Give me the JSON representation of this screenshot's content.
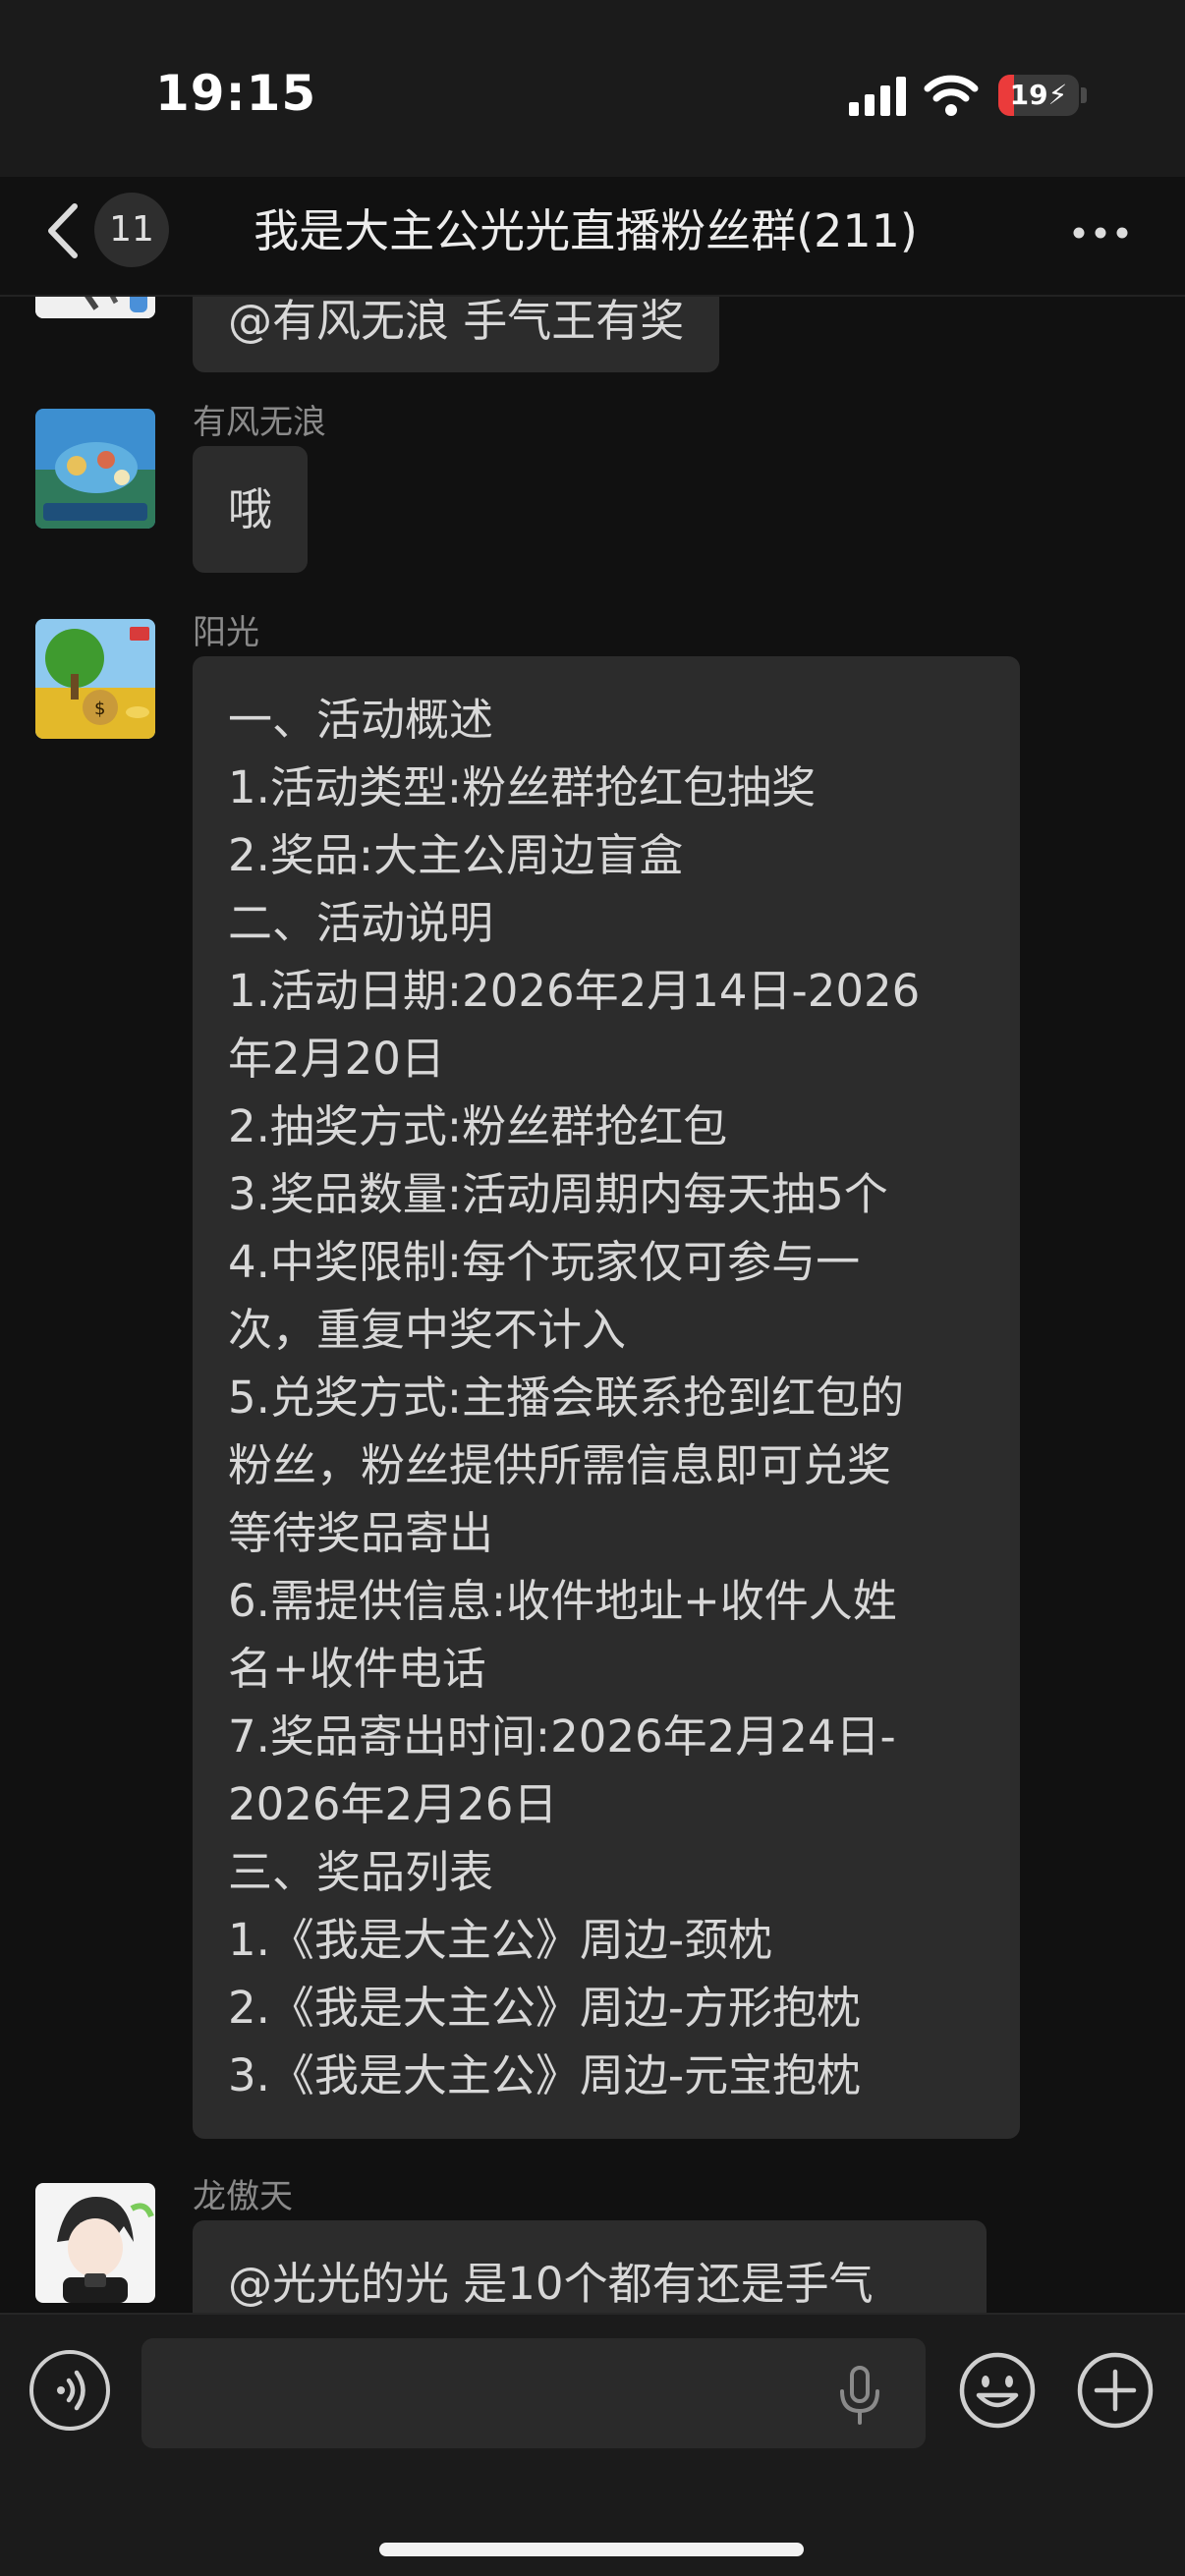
{
  "status_bar": {
    "time": "19:15",
    "battery_level": "19",
    "battery_color": "#eb3b3b",
    "icons": [
      "signal-icon",
      "wifi-icon",
      "battery-icon"
    ]
  },
  "header": {
    "back_icon": "chevron-left-icon",
    "unread_count": "11",
    "title": "我是大主公光光直播粉丝群(211)",
    "more_icon": "ellipsis-icon"
  },
  "messages": [
    {
      "sender": "",
      "lines": [
        "@有风无浪 手气王有奖"
      ]
    },
    {
      "sender": "有风无浪",
      "lines": [
        "哦"
      ]
    },
    {
      "sender": "阳光",
      "lines": [
        "一、活动概述",
        "1.活动类型:粉丝群抢红包抽奖",
        "2.奖品:大主公周边盲盒",
        "二、活动说明",
        "1.活动日期:2026年2月14日-2026",
        "年2月20日",
        "2.抽奖方式:粉丝群抢红包",
        "3.奖品数量:活动周期内每天抽5个",
        "4.中奖限制:每个玩家仅可参与一",
        "次，重复中奖不计入",
        "5.兑奖方式:主播会联系抢到红包的",
        "粉丝，粉丝提供所需信息即可兑奖",
        "等待奖品寄出",
        "6.需提供信息:收件地址+收件人姓",
        "名+收件电话",
        "7.奖品寄出时间:2026年2月24日-",
        "2026年2月26日",
        "三、奖品列表",
        "1.《我是大主公》周边-颈枕",
        "2.《我是大主公》周边-方形抱枕",
        "3.《我是大主公》周边-元宝抱枕"
      ]
    },
    {
      "sender": "龙傲天",
      "lines": [
        "@光光的光 是10个都有还是手气"
      ]
    }
  ],
  "input_bar": {
    "placeholder": "",
    "value": "",
    "icons": [
      "voice-icon",
      "microphone-icon",
      "emoji-icon",
      "plus-icon"
    ]
  }
}
